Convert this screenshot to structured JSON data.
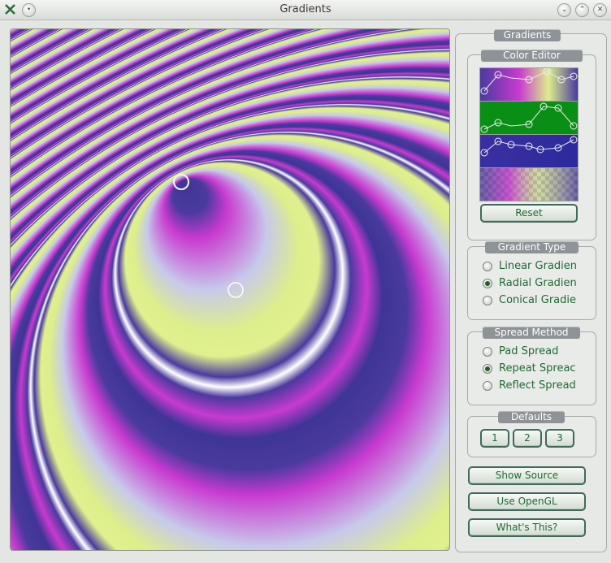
{
  "window": {
    "title": "Gradients",
    "close_icon": "x-app-icon",
    "menu_icon": "circle-menu-icon"
  },
  "panel": {
    "title": "Gradients",
    "color_editor": {
      "title": "Color Editor",
      "reset_label": "Reset"
    },
    "gradient_type": {
      "title": "Gradient Type",
      "options": [
        {
          "label": "Linear Gradien",
          "checked": false
        },
        {
          "label": "Radial Gradien",
          "checked": true
        },
        {
          "label": "Conical Gradie",
          "checked": false
        }
      ]
    },
    "spread_method": {
      "title": "Spread Method",
      "options": [
        {
          "label": "Pad Spread",
          "checked": false
        },
        {
          "label": "Repeat Spreac",
          "checked": true
        },
        {
          "label": "Reflect Spread",
          "checked": false
        }
      ]
    },
    "defaults": {
      "title": "Defaults",
      "buttons": [
        "1",
        "2",
        "3"
      ]
    },
    "show_source_label": "Show Source",
    "use_opengl_label": "Use OpenGL",
    "whats_this_label": "What's This?"
  },
  "colors": {
    "magenta": "#c83ad0",
    "indigo": "#4a3a9e",
    "lavender": "#c7c9ea",
    "yellow": "#ddee8c",
    "accent_text": "#1e6a32"
  }
}
